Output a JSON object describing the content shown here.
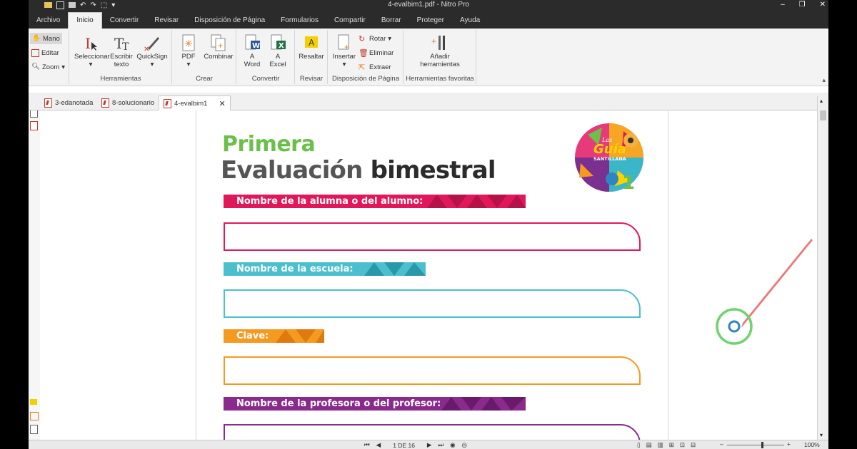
{
  "window": {
    "title": "4-evalbim1.pdf - Nitro Pro",
    "controls": [
      "–",
      "❐",
      "✕"
    ]
  },
  "ribbon_tabs": [
    "Archivo",
    "Inicio",
    "Convertir",
    "Revisar",
    "Disposición de Página",
    "Formularios",
    "Compartir",
    "Borrar",
    "Proteger",
    "Ayuda"
  ],
  "ribbon": {
    "mode": {
      "mano": "Mano",
      "editar": "Editar",
      "zoom": "Zoom"
    },
    "herramientas": {
      "seleccionar": "Seleccionar",
      "escribir1": "Escribir",
      "escribir2": "texto",
      "quicksign": "QuickSign",
      "label": "Herramientas"
    },
    "crear": {
      "pdf": "PDF",
      "combinar": "Combinar",
      "label": "Crear"
    },
    "convertir": {
      "word1": "A",
      "word2": "Word",
      "excel1": "A",
      "excel2": "Excel",
      "label": "Convertir"
    },
    "revisar": {
      "resaltar": "Resaltar",
      "label": "Revisar"
    },
    "disposicion": {
      "insertar": "Insertar",
      "rotar": "Rotar",
      "eliminar": "Eliminar",
      "extraer": "Extraer",
      "label": "Disposición de Página"
    },
    "favoritas": {
      "anadir1": "Añadir",
      "anadir2": "herramientas",
      "label": "Herramientas favoritas"
    }
  },
  "doc_tabs": [
    {
      "label": "3-edanotada"
    },
    {
      "label": "8-solucionario"
    },
    {
      "label": "4-evalbim1"
    }
  ],
  "document": {
    "title1": "Primera",
    "title2a": "Evaluación",
    "title2b": "bimestral",
    "fields": [
      {
        "label": "Nombre de la alumna o del alumno:",
        "color": "#e0185a"
      },
      {
        "label": "Nombre de la escuela:",
        "color": "#4bbfce"
      },
      {
        "label": "Clave:",
        "color": "#f59a20"
      },
      {
        "label": "Nombre de la profesora o del profesor:",
        "color": "#8a2a8c"
      }
    ],
    "logo": {
      "top": "Las",
      "word": "Guía",
      "brand": "SANTILLANA",
      "number": "1"
    }
  },
  "status": {
    "page": "1 DE 16",
    "zoom": "100%"
  }
}
